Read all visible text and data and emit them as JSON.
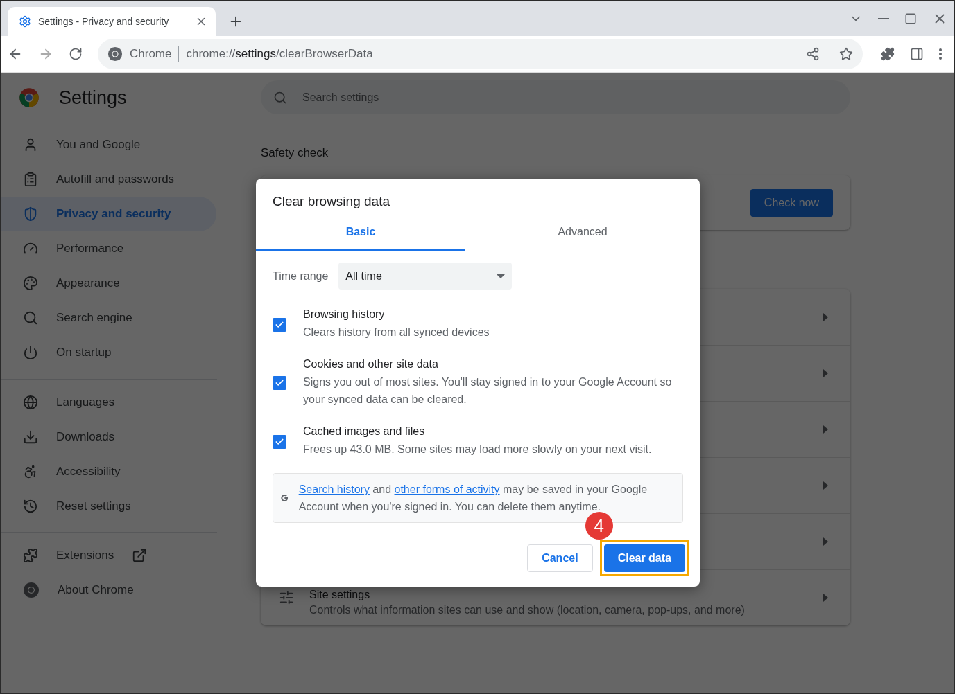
{
  "browser": {
    "tabs": [
      {
        "title": "Settings - Privacy and security",
        "selected": true
      }
    ],
    "omnibox": {
      "site_label": "Chrome",
      "url": "chrome://**settings**/clearBrowserData"
    }
  },
  "sidebar": {
    "title": "Settings",
    "groups": [
      [
        {
          "label": "You and Google",
          "selected": false,
          "external": false
        },
        {
          "label": "Autofill and passwords",
          "selected": false,
          "external": false
        },
        {
          "label": "Privacy and security",
          "selected": true,
          "external": false
        },
        {
          "label": "Performance",
          "selected": false,
          "external": false
        },
        {
          "label": "Appearance",
          "selected": false,
          "external": false
        },
        {
          "label": "Search engine",
          "selected": false,
          "external": false
        },
        {
          "label": "On startup",
          "selected": false,
          "external": false
        }
      ],
      [
        {
          "label": "Languages",
          "selected": false,
          "external": false
        },
        {
          "label": "Downloads",
          "selected": false,
          "external": false
        },
        {
          "label": "Accessibility",
          "selected": false,
          "external": false
        },
        {
          "label": "Reset settings",
          "selected": false,
          "external": false
        }
      ],
      [
        {
          "label": "Extensions",
          "selected": false,
          "external": true
        },
        {
          "label": "About Chrome",
          "selected": false,
          "external": false
        }
      ]
    ]
  },
  "search": {
    "placeholder": "Search settings"
  },
  "safety_check": {
    "heading": "Safety check",
    "button": "Check now"
  },
  "privacy_rows": [
    {
      "title": "Site settings",
      "description": "Controls what information sites can use and show (location, camera, pop-ups, and more)"
    }
  ],
  "dialog": {
    "title": "Clear browsing data",
    "tabs": [
      {
        "label": "Basic",
        "selected": true
      },
      {
        "label": "Advanced",
        "selected": false
      }
    ],
    "time_range": {
      "label": "Time range",
      "value": "All time"
    },
    "options": [
      {
        "title": "Browsing history",
        "description": "Clears history from all synced devices",
        "checked": true
      },
      {
        "title": "Cookies and other site data",
        "description": "Signs you out of most sites. You'll stay signed in to your Google Account so your synced data can be cleared.",
        "checked": true
      },
      {
        "title": "Cached images and files",
        "description": "Frees up 43.0 MB. Some sites may load more slowly on your next visit.",
        "checked": true
      }
    ],
    "notice": [
      {
        "kind": "link",
        "text": "Search history"
      },
      {
        "kind": "text",
        "text": " and "
      },
      {
        "kind": "link",
        "text": "other forms of activity"
      },
      {
        "kind": "text",
        "text": " may be saved in your Google Account when you're signed in. You can delete them anytime."
      }
    ],
    "buttons": [
      {
        "label": "Cancel",
        "kind": "secondary",
        "highlighted": false
      },
      {
        "label": "Clear data",
        "kind": "primary",
        "highlighted": true,
        "step": "4"
      }
    ]
  }
}
